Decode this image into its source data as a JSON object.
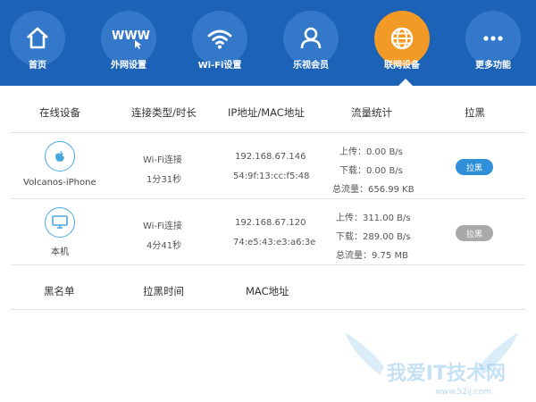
{
  "nav": {
    "items": [
      {
        "label": "首页",
        "icon": "home-icon"
      },
      {
        "label": "外网设置",
        "icon": "www-cursor-icon"
      },
      {
        "label": "Wi-Fi设置",
        "icon": "wifi-icon"
      },
      {
        "label": "乐视会员",
        "icon": "user-icon"
      },
      {
        "label": "联网设备",
        "icon": "globe-icon",
        "active": true
      },
      {
        "label": "更多功能",
        "icon": "more-dots-icon"
      }
    ],
    "www_text": "WWW"
  },
  "table": {
    "headers": [
      "在线设备",
      "连接类型/时长",
      "IP地址/MAC地址",
      "流量统计",
      "拉黑"
    ],
    "rows": [
      {
        "device_name": "Volcanos-iPhone",
        "device_icon": "apple-icon",
        "conn_type": "Wi-Fi连接",
        "duration": "1分31秒",
        "ip": "192.168.67.146",
        "mac": "54:9f:13:cc:f5:48",
        "upload": "上传：0.00 B/s",
        "download": "下载：0.00 B/s",
        "total": "总流量：656.99 KB",
        "block_label": "拉黑",
        "block_enabled": true
      },
      {
        "device_name": "本机",
        "device_icon": "computer-icon",
        "conn_type": "Wi-Fi连接",
        "duration": "4分41秒",
        "ip": "192.168.67.120",
        "mac": "74:e5:43:e3:a6:3e",
        "upload": "上传：311.00 B/s",
        "download": "下载：289.00 B/s",
        "total": "总流量：9.75 MB",
        "block_label": "拉黑",
        "block_enabled": false
      }
    ]
  },
  "blacklist": {
    "headers": [
      "黑名单",
      "拉黑时间",
      "MAC地址"
    ]
  },
  "watermark": {
    "text": "我爱IT技术网",
    "url": "www.52ij.com"
  },
  "colors": {
    "topbar": "#1c63b8",
    "nav_circle": "#3479c9",
    "nav_active": "#f29a26",
    "button_blue": "#2f8fd8",
    "button_gray": "#a9a9a9",
    "icon_outline": "#4aa7e0"
  }
}
